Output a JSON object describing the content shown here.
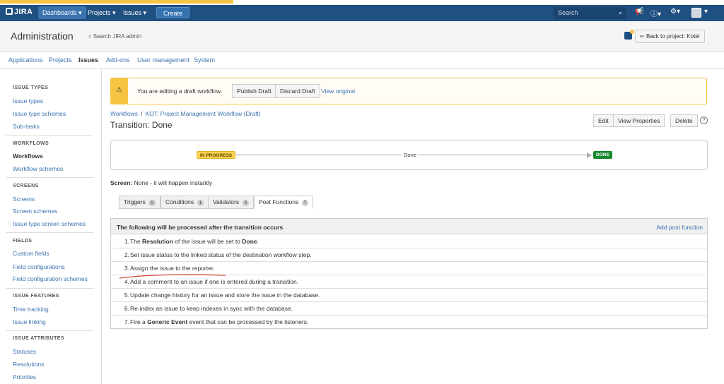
{
  "topnav": {
    "logo": "JIRA",
    "dashboards": "Dashboards",
    "projects": "Projects",
    "issues": "Issues",
    "create": "Create",
    "search_placeholder": "Search"
  },
  "header": {
    "title": "Administration",
    "search": "Search JIRA admin",
    "back_button": "Back to project: Kotel"
  },
  "admin_tabs": [
    "Applications",
    "Projects",
    "Issues",
    "Add-ons",
    "User management",
    "System"
  ],
  "sidebar": {
    "issue_types": {
      "heading": "ISSUE TYPES",
      "items": [
        "Issue types",
        "Issue type schemes",
        "Sub-tasks"
      ]
    },
    "workflows": {
      "heading": "WORKFLOWS",
      "items": [
        "Workflows",
        "Workflow schemes"
      ]
    },
    "screens": {
      "heading": "SCREENS",
      "items": [
        "Screens",
        "Screen schemes",
        "Issue type screen schemes"
      ]
    },
    "fields": {
      "heading": "FIELDS",
      "items": [
        "Custom fields",
        "Field configurations",
        "Field configuration schemes"
      ]
    },
    "issue_features": {
      "heading": "ISSUE FEATURES",
      "items": [
        "Time tracking",
        "Issue linking"
      ]
    },
    "issue_attributes": {
      "heading": "ISSUE ATTRIBUTES",
      "items": [
        "Statuses",
        "Resolutions",
        "Priorities"
      ]
    }
  },
  "draft": {
    "message": "You are editing a draft workflow.",
    "publish": "Publish Draft",
    "discard": "Discard Draft",
    "view_original": "View original"
  },
  "breadcrumb": {
    "workflows": "Workflows",
    "sep": "/",
    "workflow": "KOT: Project Management Workflow (Draft)"
  },
  "transition_title": "Transition: Done",
  "actions": {
    "edit": "Edit",
    "view_properties": "View Properties",
    "delete": "Delete",
    "help": "?"
  },
  "diagram": {
    "from": "IN PROGRESS",
    "transition": "Done",
    "to": "DONE"
  },
  "screen": {
    "label": "Screen:",
    "value": "None - it will happen instantly"
  },
  "tabs": [
    {
      "label": "Triggers",
      "count": "0"
    },
    {
      "label": "Conditions",
      "count": "1"
    },
    {
      "label": "Validators",
      "count": "0"
    },
    {
      "label": "Post Functions",
      "count": "7"
    }
  ],
  "post_functions": {
    "heading": "The following will be processed after the transition occurs",
    "add": "Add post function",
    "rows": [
      {
        "num": "1.",
        "pre": "The ",
        "bold": "Resolution",
        "mid": " of the issue will be set to ",
        "bold2": "Done",
        "post": "."
      },
      {
        "num": "2.",
        "pre": "Set issue status to the linked status of the destination workflow step.",
        "bold": "",
        "mid": "",
        "bold2": "",
        "post": ""
      },
      {
        "num": "3.",
        "pre": "Assign the issue to the reporter.",
        "bold": "",
        "mid": "",
        "bold2": "",
        "post": ""
      },
      {
        "num": "4.",
        "pre": "Add a comment to an issue if one is entered during a transition.",
        "bold": "",
        "mid": "",
        "bold2": "",
        "post": ""
      },
      {
        "num": "5.",
        "pre": "Update change history for an issue and store the issue in the database.",
        "bold": "",
        "mid": "",
        "bold2": "",
        "post": ""
      },
      {
        "num": "6.",
        "pre": "Re-index an issue to keep indexes in sync with the database.",
        "bold": "",
        "mid": "",
        "bold2": "",
        "post": ""
      },
      {
        "num": "7.",
        "pre": "Fire a ",
        "bold": "Generic Event",
        "mid": " event that can be processed by the listeners.",
        "bold2": "",
        "post": ""
      }
    ]
  },
  "colors": {
    "topbar": "#205081",
    "link": "#3b73af",
    "in_progress": "#ffd351",
    "done": "#14892c",
    "annotation": "#d04437"
  }
}
